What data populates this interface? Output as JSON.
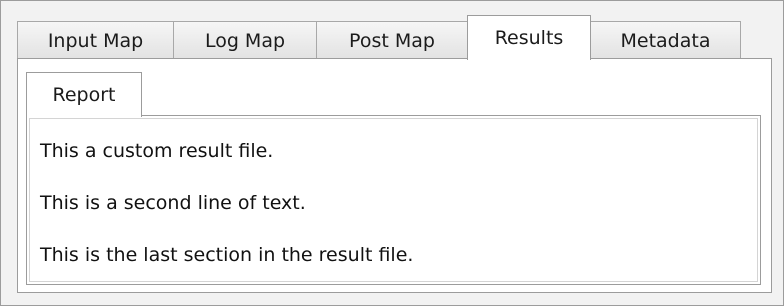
{
  "top_tabs": [
    {
      "label": "Input Map"
    },
    {
      "label": "Log Map"
    },
    {
      "label": "Post Map"
    },
    {
      "label": "Results"
    },
    {
      "label": "Metadata"
    }
  ],
  "active_tab": "Results",
  "sub_tabs": [
    {
      "label": "Report"
    }
  ],
  "report": {
    "lines": [
      "This a custom result file.",
      "This is a second line of text.",
      "This is the last section in the result file."
    ]
  }
}
